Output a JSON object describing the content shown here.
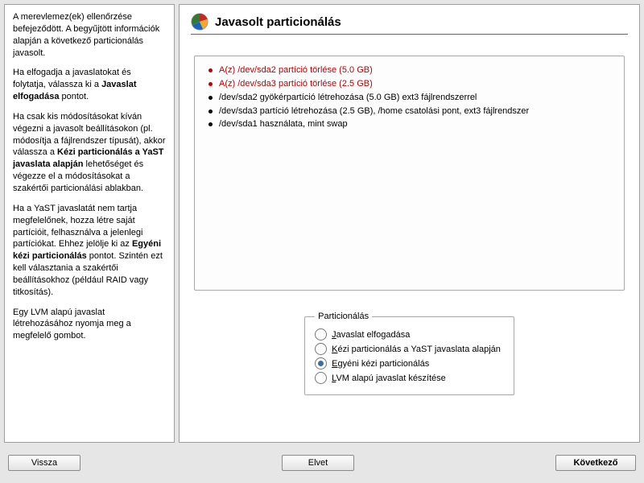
{
  "hint": {
    "p1_a": "A merevlemez(ek) ellenőrzése befejeződött. A begyűjtött információk alapján a következő particionálás javasolt.",
    "p2_a": "Ha elfogadja a javaslatokat és folytatja, válassza ki a ",
    "p2_b": "Javaslat elfogadása",
    "p2_c": " pontot.",
    "p3_a": "Ha csak kis módosításokat kíván végezni a javasolt beállításokon (pl. módosítja a fájlrendszer típusát), akkor válassza a ",
    "p3_b": "Kézi particionálás a YaST javaslata alapján",
    "p3_c": " lehetőséget és végezze el a módosításokat a szakértői particionálási ablakban.",
    "p4_a": "Ha a YaST javaslatát nem tartja megfelelőnek, hozza létre saját partícióit, felhasználva a jelenlegi partíciókat. Ehhez jelölje ki az ",
    "p4_b": "Egyéni kézi particionálás",
    "p4_c": " pontot. Szintén ezt kell választania a szakértői beállításokhoz (például RAID vagy titkosítás).",
    "p5_a": "Egy LVM alapú javaslat létrehozásához nyomja meg a megfelelő gombot."
  },
  "title": "Javasolt particionálás",
  "proposal": {
    "l1": "A(z) /dev/sda2 partíció törlése (5.0 GB)",
    "l2": "A(z) /dev/sda3 partíció törlése (2.5 GB)",
    "l3": "/dev/sda2 gyökérpartíció létrehozása (5.0 GB) ext3 fájlrendszerrel",
    "l4": "/dev/sda3 partíció létrehozása (2.5 GB), /home csatolási pont, ext3 fájlrendszer",
    "l5": "/dev/sda1 használata, mint swap"
  },
  "group": {
    "legend": "Particionálás",
    "o1_a": "J",
    "o1_b": "avaslat elfogadása",
    "o2_a": "K",
    "o2_b": "ézi particionálás a YaST javaslata alapján",
    "o3_a": "E",
    "o3_b": "gyéni kézi particionálás",
    "o4_a": "L",
    "o4_b": "VM alapú javaslat készítése"
  },
  "footer": {
    "back": "Vissza",
    "abort": "Elvet",
    "next": "Következő"
  },
  "selected": "custom"
}
